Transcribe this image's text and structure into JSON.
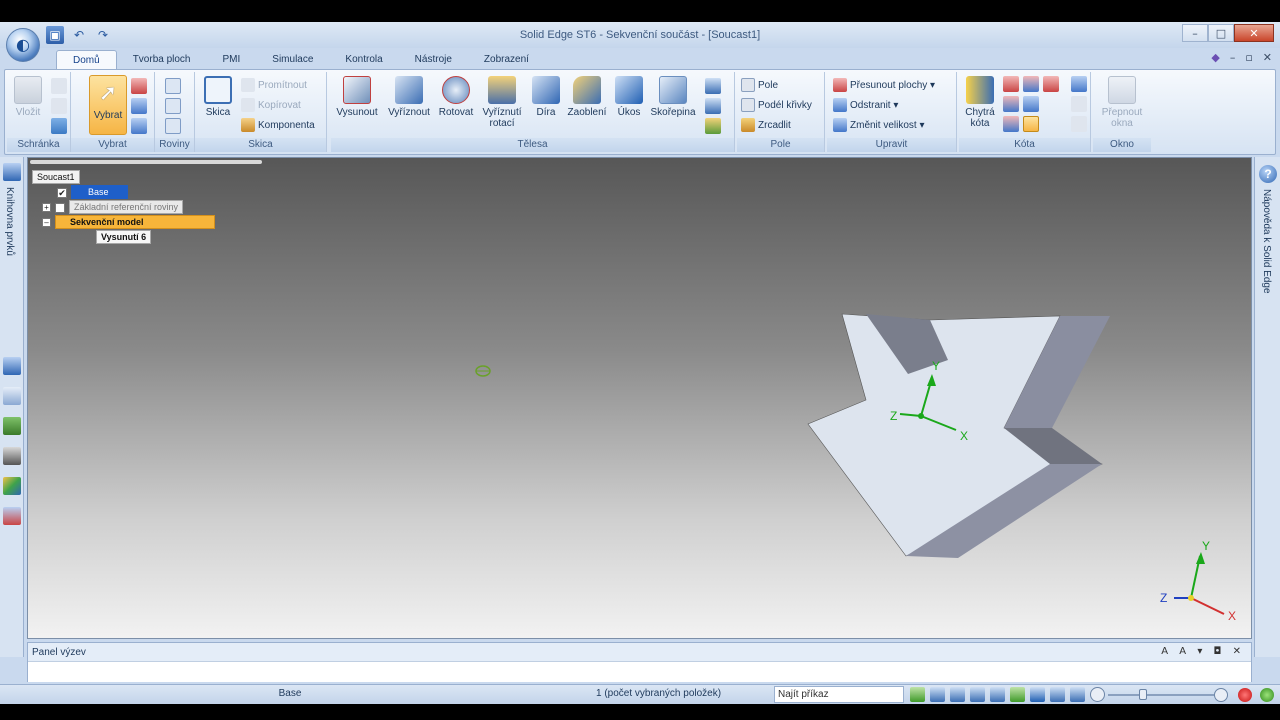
{
  "window": {
    "title": "Solid Edge ST6 - Sekvenční součást - [Soucast1]",
    "controls": [
      "–",
      "□",
      "✕"
    ],
    "doc_controls": [
      "◆",
      "–",
      "▫",
      "✕"
    ]
  },
  "tabs": [
    "Domů",
    "Tvorba ploch",
    "PMI",
    "Simulace",
    "Kontrola",
    "Nástroje",
    "Zobrazení"
  ],
  "active_tab": "Domů",
  "ribbon": {
    "groups": {
      "clipboard": "Schránka",
      "select": "Vybrat",
      "planes": "Roviny",
      "sketch": "Skica",
      "solids": "Tělesa",
      "pattern": "Pole",
      "modify": "Upravit",
      "dimension": "Kóta",
      "window": "Okno"
    },
    "buttons": {
      "paste": "Vložit",
      "select": "Vybrat",
      "sketch": "Skica",
      "project": "Promítnout",
      "include": "Kopírovat",
      "component": "Komponenta",
      "extrude": "Vysunout",
      "cutout": "Vyříznout",
      "revolve": "Rotovat",
      "revolved_cutout": "Vyříznutí rotací",
      "hole": "Díra",
      "round": "Zaoblení",
      "draft": "Úkos",
      "thin_wall": "Skořepina",
      "pattern": "Pole",
      "along_curve": "Podél křivky",
      "mirror": "Zrcadlit",
      "move_faces": "Přesunout plochy",
      "delete": "Odstranit",
      "resize": "Změnit velikost",
      "smart_dimension": "Chytrá kóta",
      "switch_windows": "Přepnout okna"
    }
  },
  "left_bar": {
    "label": "Knihovna prvků"
  },
  "right_bar": {
    "label": "Nápověda k Solid Edge",
    "help_symbol": "?"
  },
  "tree": {
    "root": "Soucast1",
    "base": "Base",
    "ref_planes": "Základní referenční roviny",
    "ordered_model": "Sekvenční model",
    "feature": "Vysunutí 6",
    "expanders": [
      "+",
      "–"
    ],
    "check": "✔"
  },
  "triad": {
    "x": "X",
    "y": "Y",
    "z": "Z"
  },
  "panel": {
    "title": "Panel výzev",
    "controls": "A A ▾ ◘ ✕"
  },
  "status": {
    "text": "Base",
    "selection_count": "1 (počet vybraných položek)",
    "command_finder_placeholder": "Najít příkaz"
  },
  "zoom_level": 0.33
}
